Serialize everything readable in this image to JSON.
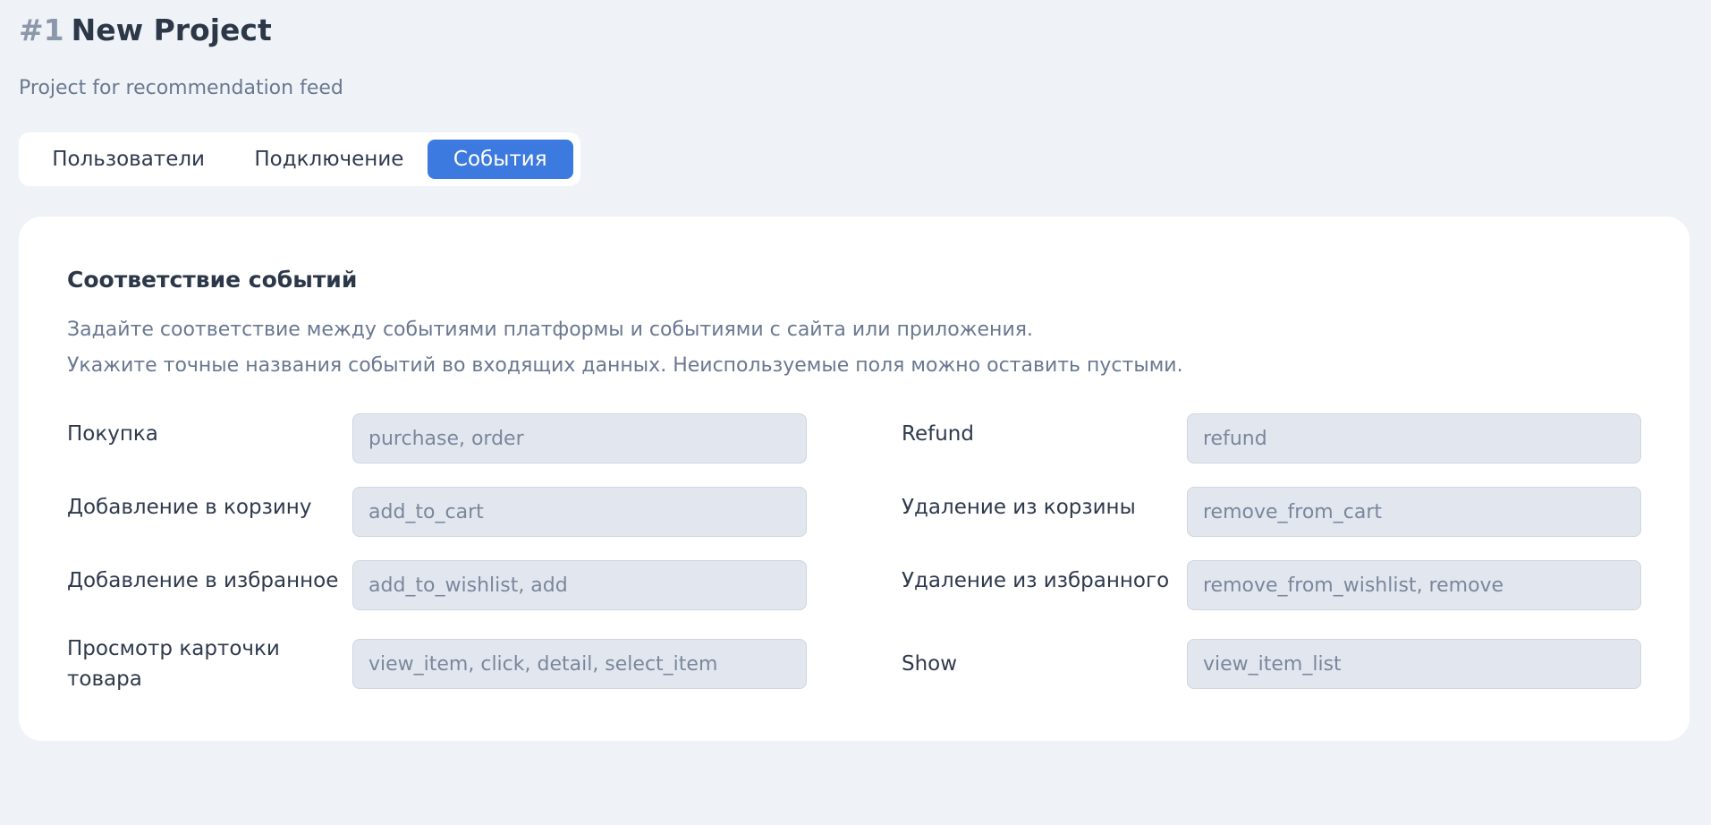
{
  "header": {
    "project_number": "#1",
    "project_name": "New Project",
    "subtitle": "Project for recommendation feed"
  },
  "tabs": [
    {
      "label": "Пользователи",
      "active": false
    },
    {
      "label": "Подключение",
      "active": false
    },
    {
      "label": "События",
      "active": true
    }
  ],
  "card": {
    "title": "Соответствие событий",
    "description_line1": "Задайте соответствие между событиями платформы и событиями с сайта или приложения.",
    "description_line2": "Укажите точные названия событий во входящих данных. Неиспользуемые поля можно оставить пустыми."
  },
  "fields": {
    "purchase": {
      "label": "Покупка",
      "value": "",
      "placeholder": "purchase, order"
    },
    "refund": {
      "label": "Refund",
      "value": "",
      "placeholder": "refund"
    },
    "add_to_cart": {
      "label": "Добавление в корзину",
      "value": "",
      "placeholder": "add_to_cart"
    },
    "remove_from_cart": {
      "label": "Удаление из корзины",
      "value": "",
      "placeholder": "remove_from_cart"
    },
    "add_to_wishlist": {
      "label": "Добавление в избранное",
      "value": "",
      "placeholder": "add_to_wishlist, add"
    },
    "remove_from_wishlist": {
      "label": "Удаление из избранного",
      "value": "",
      "placeholder": "remove_from_wishlist, remove"
    },
    "view_item": {
      "label": "Просмотр карточки товара",
      "value": "",
      "placeholder": "view_item, click, detail, select_item"
    },
    "show": {
      "label": "Show",
      "value": "",
      "placeholder": "view_item_list"
    }
  },
  "colors": {
    "accent": "#3d7ae0",
    "background": "#eff3f8",
    "card": "#ffffff",
    "input_bg": "#e2e7ef"
  }
}
